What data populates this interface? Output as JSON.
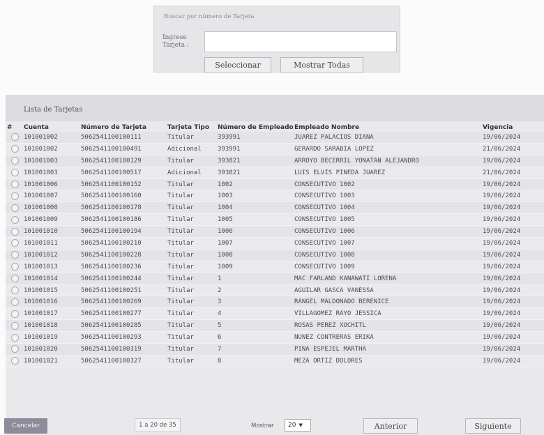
{
  "search": {
    "title": "Buscar por número de Tarjeta",
    "label": "Ingrese Tarjeta :",
    "input_value": "",
    "select_button": "Seleccionar",
    "show_all_button": "Mostrar Todas"
  },
  "list": {
    "title": "Lista de Tarjetas",
    "columns": [
      "#",
      "Cuenta",
      "Número de Tarjeta",
      "Tarjeta Tipo",
      "Número de Empleado",
      "Empleado Nombre",
      "Vigencia"
    ],
    "rows": [
      [
        "101001002",
        "5062541100100111",
        "Titular",
        "393991",
        "JUAREZ PALACIOS DIANA",
        "19/06/2024"
      ],
      [
        "101001002",
        "5062541100100491",
        "Adicional",
        "393991",
        "GERARDO SARABIA LOPEZ",
        "21/06/2024"
      ],
      [
        "101001003",
        "5062541100100129",
        "Titular",
        "393821",
        "ARROYO BECERRIL YONATAN ALEJANDRO",
        "19/06/2024"
      ],
      [
        "101001003",
        "5062541100100517",
        "Adicional",
        "393821",
        "LUIS ELVIS PINEDA JUAREZ",
        "21/06/2024"
      ],
      [
        "101001006",
        "5062541100100152",
        "Titular",
        "1002",
        "CONSECUTIVO 1002",
        "19/06/2024"
      ],
      [
        "101001007",
        "5062541100100160",
        "Titular",
        "1003",
        "CONSECUTIVO 1003",
        "19/06/2024"
      ],
      [
        "101001008",
        "5062541100100178",
        "Titular",
        "1004",
        "CONSECUTIVO 1004",
        "19/06/2024"
      ],
      [
        "101001009",
        "5062541100100186",
        "Titular",
        "1005",
        "CONSECUTIVO 1005",
        "19/06/2024"
      ],
      [
        "101001010",
        "5062541100100194",
        "Titular",
        "1006",
        "CONSECUTIVO 1006",
        "19/06/2024"
      ],
      [
        "101001011",
        "5062541100100210",
        "Titular",
        "1007",
        "CONSECUTIVO 1007",
        "19/06/2024"
      ],
      [
        "101001012",
        "5062541100100228",
        "Titular",
        "1008",
        "CONSECUTIVO 1008",
        "19/06/2024"
      ],
      [
        "101001013",
        "5062541100100236",
        "Titular",
        "1009",
        "CONSECUTIVO 1009",
        "19/06/2024"
      ],
      [
        "101001014",
        "5062541100100244",
        "Titular",
        "1",
        "MAC FARLAND KANAWATI LORENA",
        "19/06/2024"
      ],
      [
        "101001015",
        "5062541100100251",
        "Titular",
        "2",
        "AGUILAR GASCA VANESSA",
        "19/06/2024"
      ],
      [
        "101001016",
        "5062541100100269",
        "Titular",
        "3",
        "RANGEL MALDONADO BERENICE",
        "19/06/2024"
      ],
      [
        "101001017",
        "5062541100100277",
        "Titular",
        "4",
        "VILLAGOMEZ RAYO JESSICA",
        "19/06/2024"
      ],
      [
        "101001018",
        "5062541100100285",
        "Titular",
        "5",
        "ROSAS PEREZ XOCHITL",
        "19/06/2024"
      ],
      [
        "101001019",
        "5062541100100293",
        "Titular",
        "6",
        "NUNEZ CONTRERAS ERIKA",
        "19/06/2024"
      ],
      [
        "101001020",
        "5062541100100319",
        "Titular",
        "7",
        "PINA ESPEJEL MARTHA",
        "19/06/2024"
      ],
      [
        "101001021",
        "5062541100100327",
        "Titular",
        "8",
        "MEZA ORTIZ DOLORES",
        "19/06/2024"
      ]
    ]
  },
  "footer": {
    "cancel_button": "Cancelar",
    "range": "1 a 20 de 35",
    "show_label": "Mostrar",
    "show_value": "20",
    "prev_button": "Anterior",
    "next_button": "Siguiente"
  },
  "icons": {
    "row_select": "radio-icon",
    "dropdown": "chevron-down-icon"
  }
}
